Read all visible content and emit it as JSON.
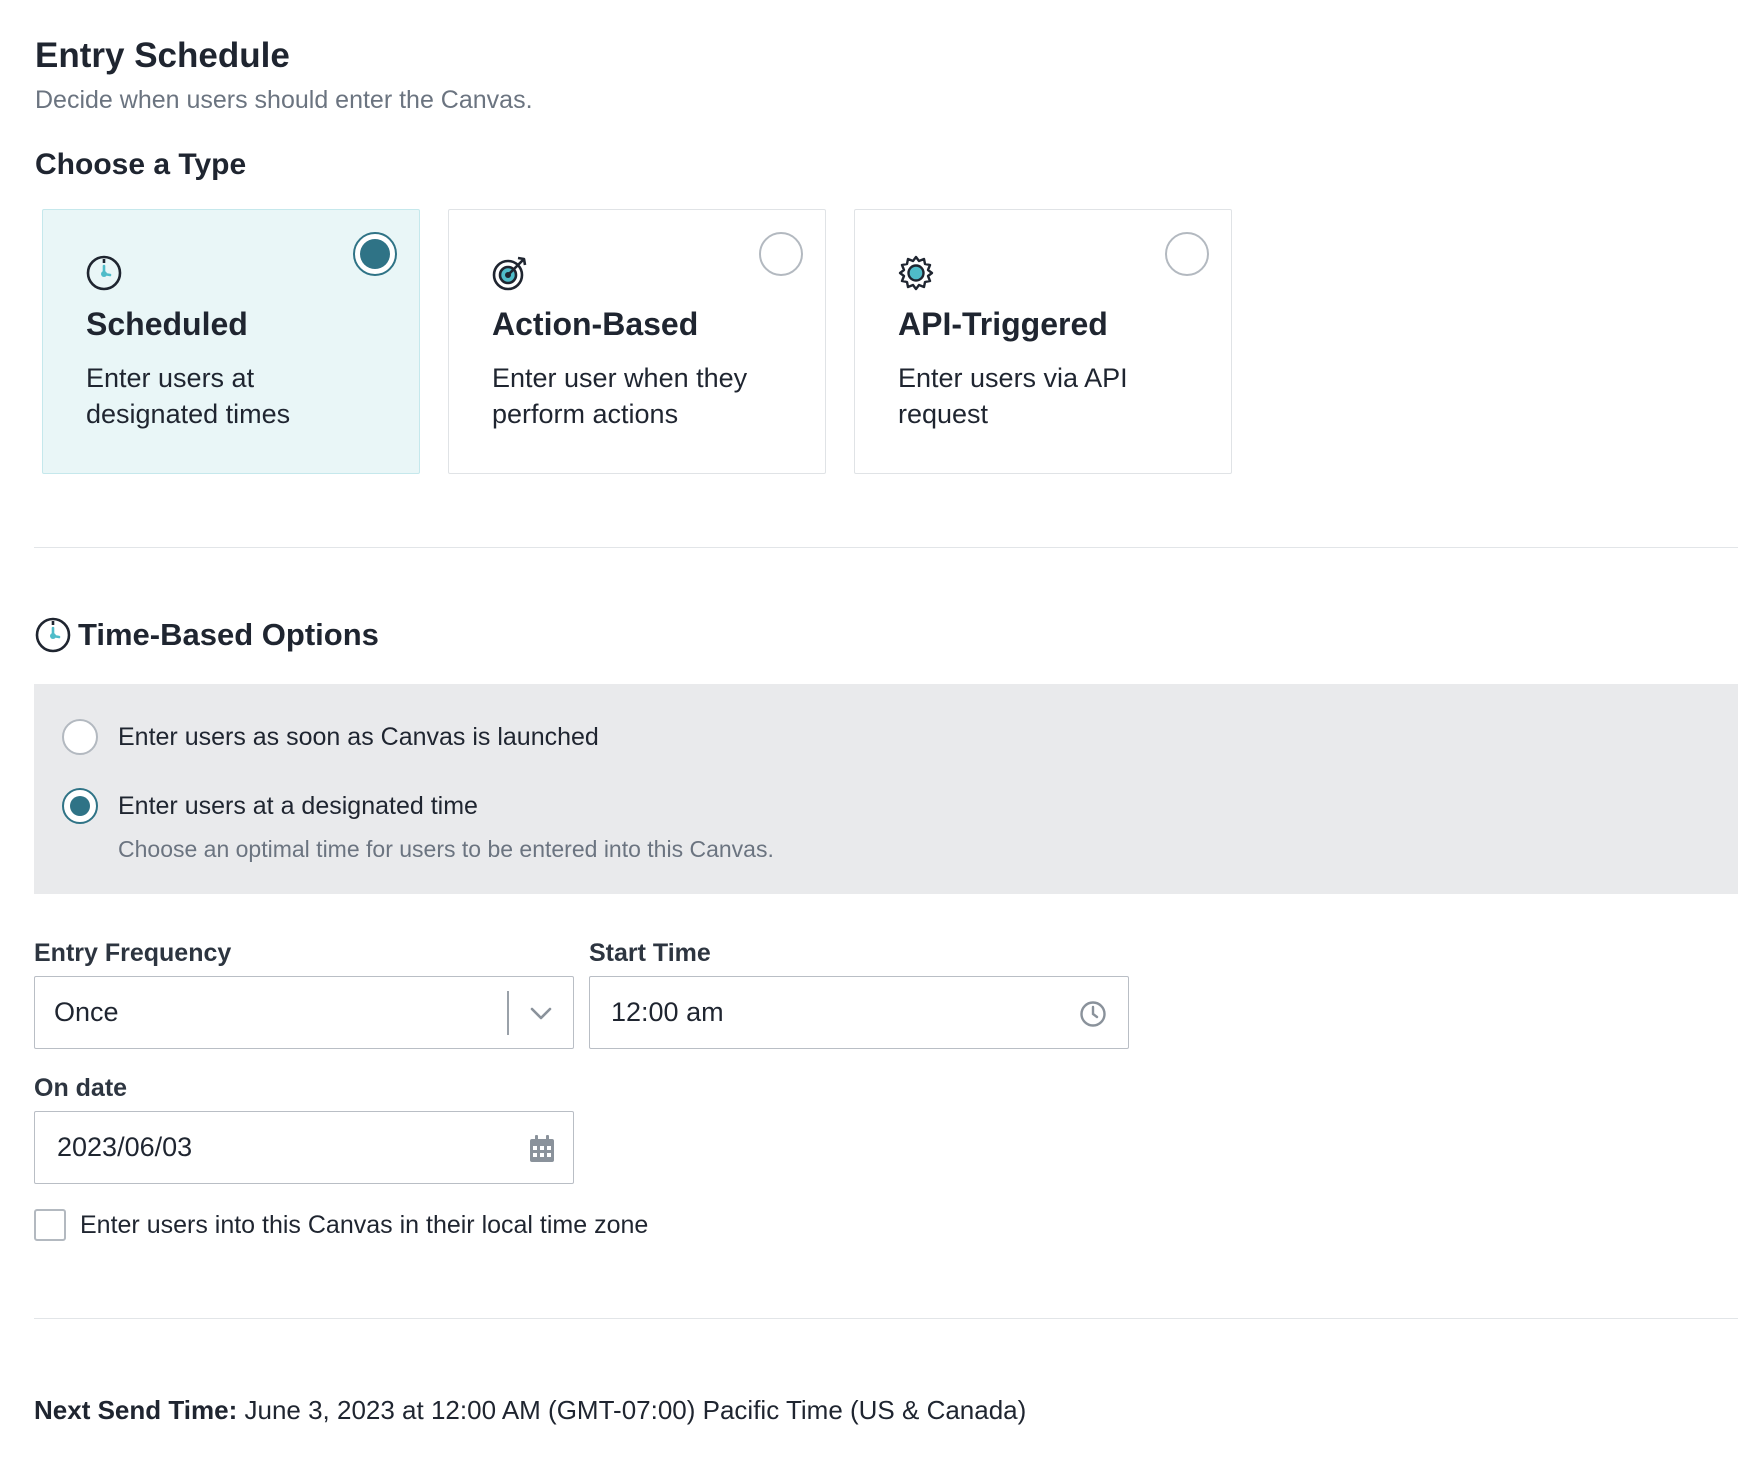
{
  "header": {
    "title": "Entry Schedule",
    "subtitle": "Decide when users should enter the Canvas."
  },
  "type_section": {
    "title": "Choose a Type",
    "cards": [
      {
        "title": "Scheduled",
        "description": "Enter users at designated times",
        "icon": "clock-icon",
        "selected": true
      },
      {
        "title": "Action-Based",
        "description": "Enter user when they perform actions",
        "icon": "target-icon",
        "selected": false
      },
      {
        "title": "API-Triggered",
        "description": "Enter users via API request",
        "icon": "gear-icon",
        "selected": false
      }
    ]
  },
  "time_options": {
    "title": "Time-Based Options",
    "options": [
      {
        "label": "Enter users as soon as Canvas is launched",
        "selected": false
      },
      {
        "label": "Enter users at a designated time",
        "selected": true,
        "help": "Choose an optimal time for users to be entered into this Canvas."
      }
    ]
  },
  "form": {
    "entry_frequency": {
      "label": "Entry Frequency",
      "value": "Once"
    },
    "start_time": {
      "label": "Start Time",
      "value": "12:00 am"
    },
    "on_date": {
      "label": "On date",
      "value": "2023/06/03"
    },
    "local_timezone": {
      "label": "Enter users into this Canvas in their local time zone",
      "checked": false
    }
  },
  "next_send": {
    "label": "Next Send Time:",
    "value": "June 3, 2023 at 12:00 AM (GMT-07:00) Pacific Time (US & Canada)"
  },
  "colors": {
    "accent": "#2f7386",
    "icon_teal": "#4fbcc9",
    "selected_card_bg": "#e9f6f7",
    "panel_bg": "#e9eaec"
  }
}
